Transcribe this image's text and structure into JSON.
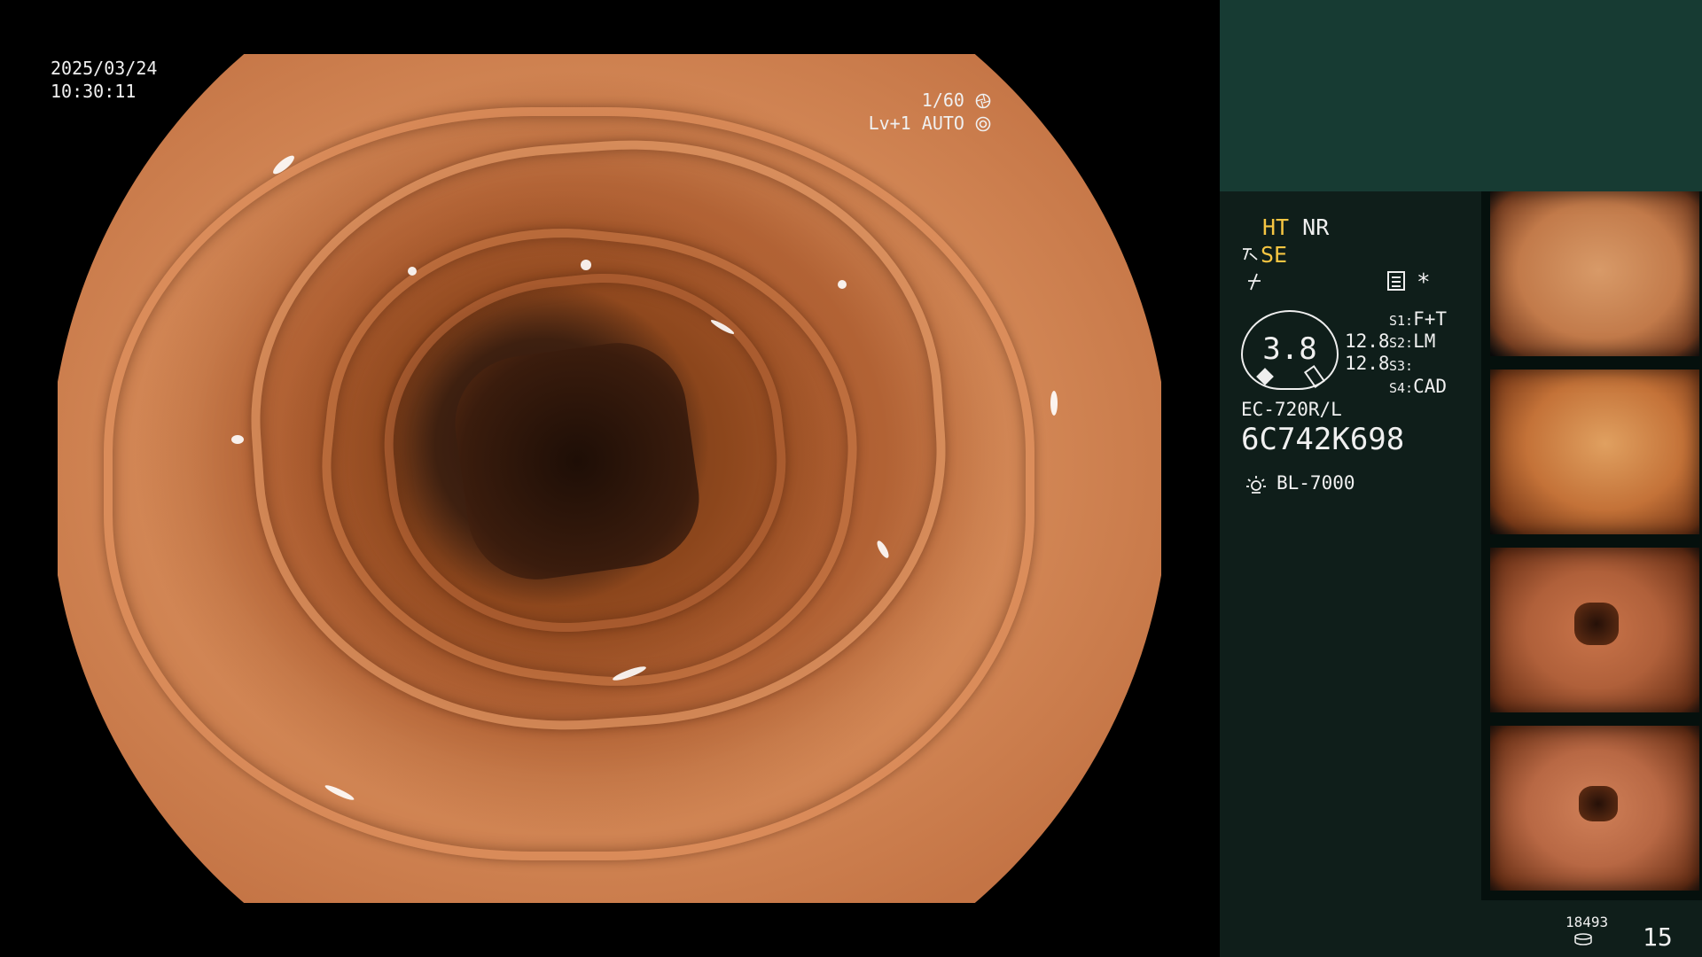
{
  "overlay": {
    "date": "2025/03/24",
    "time": "10:30:11",
    "shutter": "1/60",
    "level": "Lv+1",
    "exposure_mode": "AUTO"
  },
  "modes": {
    "ht": "HT",
    "nr": "NR",
    "se": "SE",
    "colors": {
      "active": "#f5c542",
      "normal": "#f0f0f0"
    }
  },
  "asterisk": "*",
  "gauge": {
    "value": "3.8"
  },
  "focal": {
    "first": "12.8",
    "second": "12.8"
  },
  "switches": [
    {
      "key": "S1:",
      "value": "F+T"
    },
    {
      "key": "S2:",
      "value": "LM"
    },
    {
      "key": "S3:",
      "value": ""
    },
    {
      "key": "S4:",
      "value": "CAD"
    }
  ],
  "scope": {
    "model": "EC-720R/L",
    "serial": "6C742K698",
    "light_source": "BL-7000"
  },
  "counters": {
    "storage": "18493",
    "images": "15"
  },
  "icons": [
    "shutter-icon",
    "auto-iris-icon",
    "pen-icon",
    "flash-off-icon",
    "menu-icon",
    "lamp-icon",
    "disk-icon"
  ]
}
